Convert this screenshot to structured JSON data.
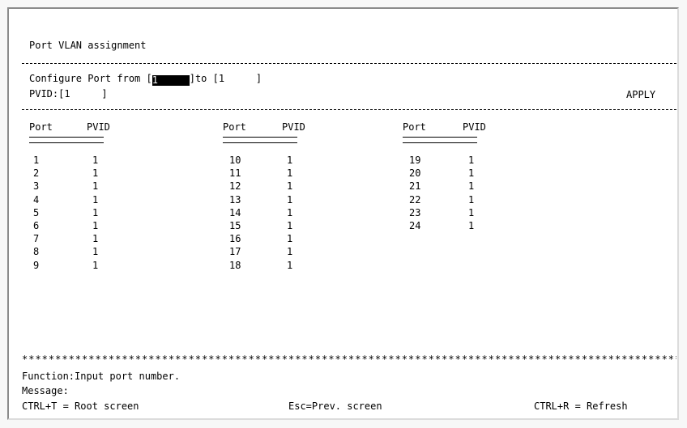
{
  "title": "Port VLAN assignment",
  "config": {
    "from_prefix": "Configure Port from [",
    "from_value": "1",
    "to_text": "]to [",
    "to_value": "1",
    "close": "]",
    "pvid_label": "PVID:[",
    "pvid_value": "1",
    "pvid_close": "]",
    "apply_label": "APPLY"
  },
  "table": {
    "header_port": "Port",
    "header_pvid": "PVID",
    "columns": [
      [
        [
          "1",
          "1"
        ],
        [
          "2",
          "1"
        ],
        [
          "3",
          "1"
        ],
        [
          "4",
          "1"
        ],
        [
          "5",
          "1"
        ],
        [
          "6",
          "1"
        ],
        [
          "7",
          "1"
        ],
        [
          "8",
          "1"
        ],
        [
          "9",
          "1"
        ]
      ],
      [
        [
          "10",
          "1"
        ],
        [
          "11",
          "1"
        ],
        [
          "12",
          "1"
        ],
        [
          "13",
          "1"
        ],
        [
          "14",
          "1"
        ],
        [
          "15",
          "1"
        ],
        [
          "16",
          "1"
        ],
        [
          "17",
          "1"
        ],
        [
          "18",
          "1"
        ]
      ],
      [
        [
          "19",
          "1"
        ],
        [
          "20",
          "1"
        ],
        [
          "21",
          "1"
        ],
        [
          "22",
          "1"
        ],
        [
          "23",
          "1"
        ],
        [
          "24",
          "1"
        ]
      ]
    ]
  },
  "footer": {
    "function_text": "Function:Input port number.",
    "message_text": "Message:",
    "root_hint": "CTRL+T = Root screen",
    "prev_hint": "Esc=Prev. screen",
    "refresh_hint": "CTRL+R = Refresh"
  }
}
